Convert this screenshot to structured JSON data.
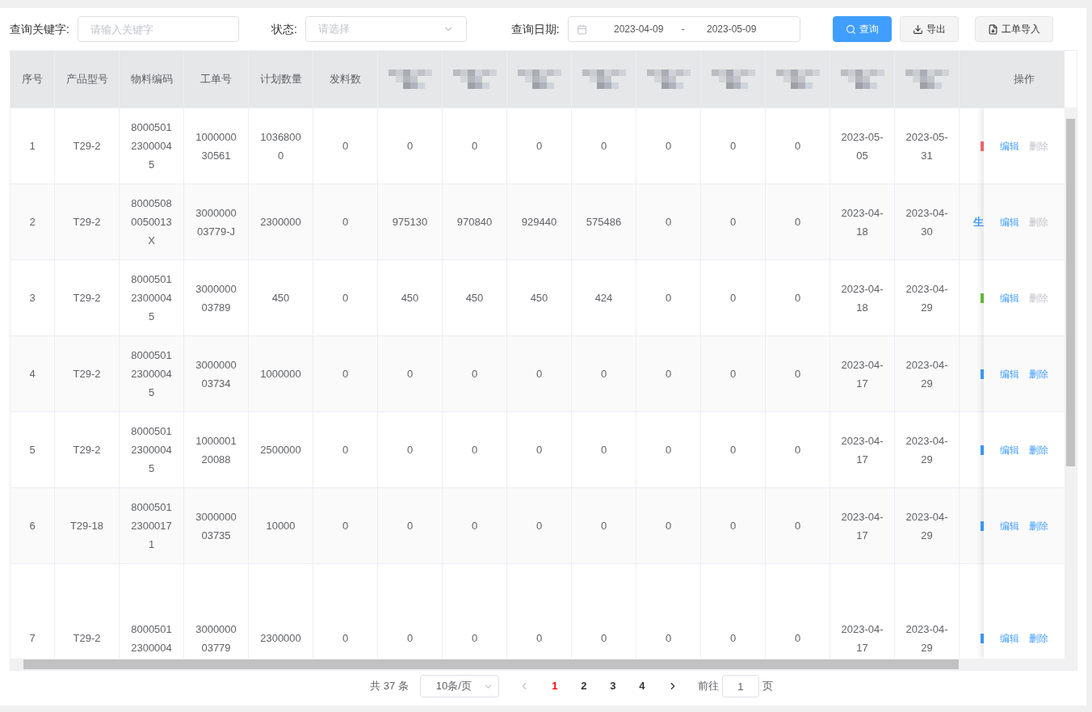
{
  "filters": {
    "keyword": {
      "label": "查询关键字:",
      "placeholder": "请输入关键字"
    },
    "status": {
      "label": "状态:",
      "placeholder": "请选择"
    },
    "date": {
      "label": "查询日期:",
      "start": "2023-04-09",
      "separator": "-",
      "end": "2023-05-09"
    }
  },
  "buttons": [
    {
      "kind": "primary",
      "label": "查询"
    },
    {
      "kind": "plain",
      "label": "导出"
    },
    {
      "kind": "plain",
      "label": "工单导入"
    }
  ],
  "table": {
    "columns": [
      {
        "kind": "text",
        "label": "序号"
      },
      {
        "kind": "text",
        "label": "产品型号"
      },
      {
        "kind": "text",
        "label": "物料编码"
      },
      {
        "kind": "text",
        "label": "工单号"
      },
      {
        "kind": "text",
        "label": "计划数量"
      },
      {
        "kind": "text",
        "label": "发料数"
      },
      {
        "kind": "redacted"
      },
      {
        "kind": "redacted"
      },
      {
        "kind": "redacted"
      },
      {
        "kind": "redacted"
      },
      {
        "kind": "redacted"
      },
      {
        "kind": "redacted"
      },
      {
        "kind": "redacted"
      },
      {
        "kind": "redacted"
      },
      {
        "kind": "redacted"
      }
    ],
    "action_column": "操作",
    "rows": [
      {
        "cells": [
          "1",
          "T29-2",
          "800050123000045",
          "100000030561",
          "10368000",
          "0",
          "0",
          "0",
          "0",
          "0",
          "0",
          "0",
          "0",
          "2023-05-05",
          "2023-05-31"
        ],
        "color": "#f56c6c",
        "edit": "编辑",
        "delete": "删除",
        "delete_disabled": true
      },
      {
        "cells": [
          "2",
          "T29-2",
          "80005080050013X",
          "300000003779-J",
          "2300000",
          "0",
          "975130",
          "970840",
          "929440",
          "575486",
          "0",
          "0",
          "0",
          "2023-04-18",
          "2023-04-30"
        ],
        "status": "生",
        "color": "#409eff",
        "edit": "编辑",
        "delete": "删除",
        "delete_disabled": true
      },
      {
        "cells": [
          "3",
          "T29-2",
          "800050123000045",
          "300000003789",
          "450",
          "0",
          "450",
          "450",
          "450",
          "424",
          "0",
          "0",
          "0",
          "2023-04-18",
          "2023-04-29"
        ],
        "color": "#67c23a",
        "edit": "编辑",
        "delete": "删除",
        "delete_disabled": true
      },
      {
        "cells": [
          "4",
          "T29-2",
          "800050123000045",
          "300000003734",
          "1000000",
          "0",
          "0",
          "0",
          "0",
          "0",
          "0",
          "0",
          "0",
          "2023-04-17",
          "2023-04-29"
        ],
        "color": "#409eff",
        "edit": "编辑",
        "delete": "删除",
        "delete_disabled": false
      },
      {
        "cells": [
          "5",
          "T29-2",
          "800050123000045",
          "100000120088",
          "2500000",
          "0",
          "0",
          "0",
          "0",
          "0",
          "0",
          "0",
          "0",
          "2023-04-17",
          "2023-04-29"
        ],
        "color": "#409eff",
        "edit": "编辑",
        "delete": "删除",
        "delete_disabled": false
      },
      {
        "cells": [
          "6",
          "T29-18",
          "800050123000171",
          "300000003735",
          "10000",
          "0",
          "0",
          "0",
          "0",
          "0",
          "0",
          "0",
          "0",
          "2023-04-17",
          "2023-04-29"
        ],
        "color": "#409eff",
        "edit": "编辑",
        "delete": "删除",
        "delete_disabled": false
      },
      {
        "cells": [
          "7",
          "T29-2",
          "80005012300004",
          "300000003779",
          "2300000",
          "0",
          "0",
          "0",
          "0",
          "0",
          "0",
          "0",
          "0",
          "2023-04-17",
          "2023-04-29"
        ],
        "color": "#409eff",
        "edit": "编辑",
        "delete": "删除",
        "delete_disabled": false
      }
    ]
  },
  "pagination": {
    "total": "共 37 条",
    "page_size": "10条/页",
    "pages": [
      {
        "label": "1",
        "selected": true
      },
      {
        "label": "2",
        "selected": false
      },
      {
        "label": "3",
        "selected": false
      },
      {
        "label": "4",
        "selected": false
      }
    ],
    "goto_label": "前往",
    "goto_value": "1",
    "goto_suffix": "页"
  }
}
